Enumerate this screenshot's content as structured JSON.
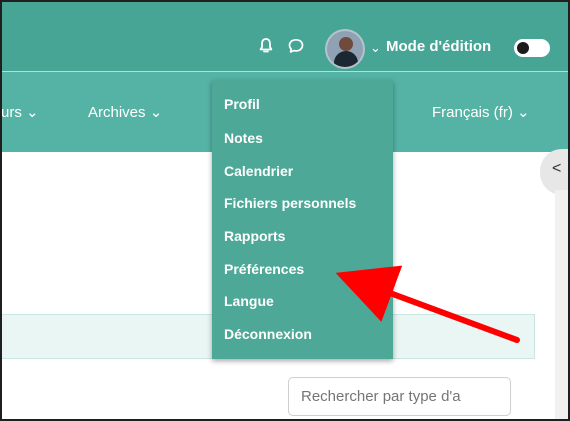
{
  "header": {
    "edit_mode_label": "Mode d'édition",
    "icons": [
      "bell-icon",
      "chat-icon",
      "avatar",
      "chevron-down-icon"
    ],
    "edit_mode_enabled": true
  },
  "nav": {
    "items": [
      {
        "label": "urs",
        "icon": "chevron-down-icon"
      },
      {
        "label": "Archives",
        "icon": "chevron-down-icon"
      },
      {
        "label": "Français (fr)",
        "icon": "chevron-down-icon"
      }
    ]
  },
  "user_menu": {
    "items": [
      "Profil",
      "Notes",
      "Calendrier",
      "Fichiers personnels",
      "Rapports",
      "Préférences",
      "Langue",
      "Déconnexion"
    ],
    "has_submenu": [
      "Langue"
    ]
  },
  "search": {
    "placeholder": "Rechercher par type d'a"
  },
  "drawer": {
    "toggle_icon": "chevron-left-icon"
  },
  "colors": {
    "topbar": "#47a595",
    "navbar": "#55b3a5",
    "menu": "#4ea897",
    "annotation_arrow": "#ff0000"
  }
}
